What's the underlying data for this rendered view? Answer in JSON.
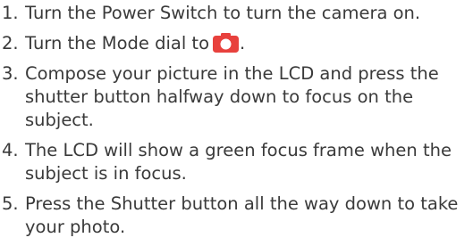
{
  "steps": [
    {
      "number": "1.",
      "text": "Turn the Power Switch to turn the camera on."
    },
    {
      "number": "2.",
      "text_before": "Turn the Mode dial to",
      "text_after": ".",
      "icon": "camera-icon",
      "icon_color": "#e8413d"
    },
    {
      "number": "3.",
      "text": "Compose your picture in the LCD and press the shutter button halfway down to focus on the subject."
    },
    {
      "number": "4.",
      "text": "The LCD will show a green focus frame when the subject is in focus."
    },
    {
      "number": "5.",
      "text": "Press the Shutter button all the way down to take your photo."
    }
  ]
}
